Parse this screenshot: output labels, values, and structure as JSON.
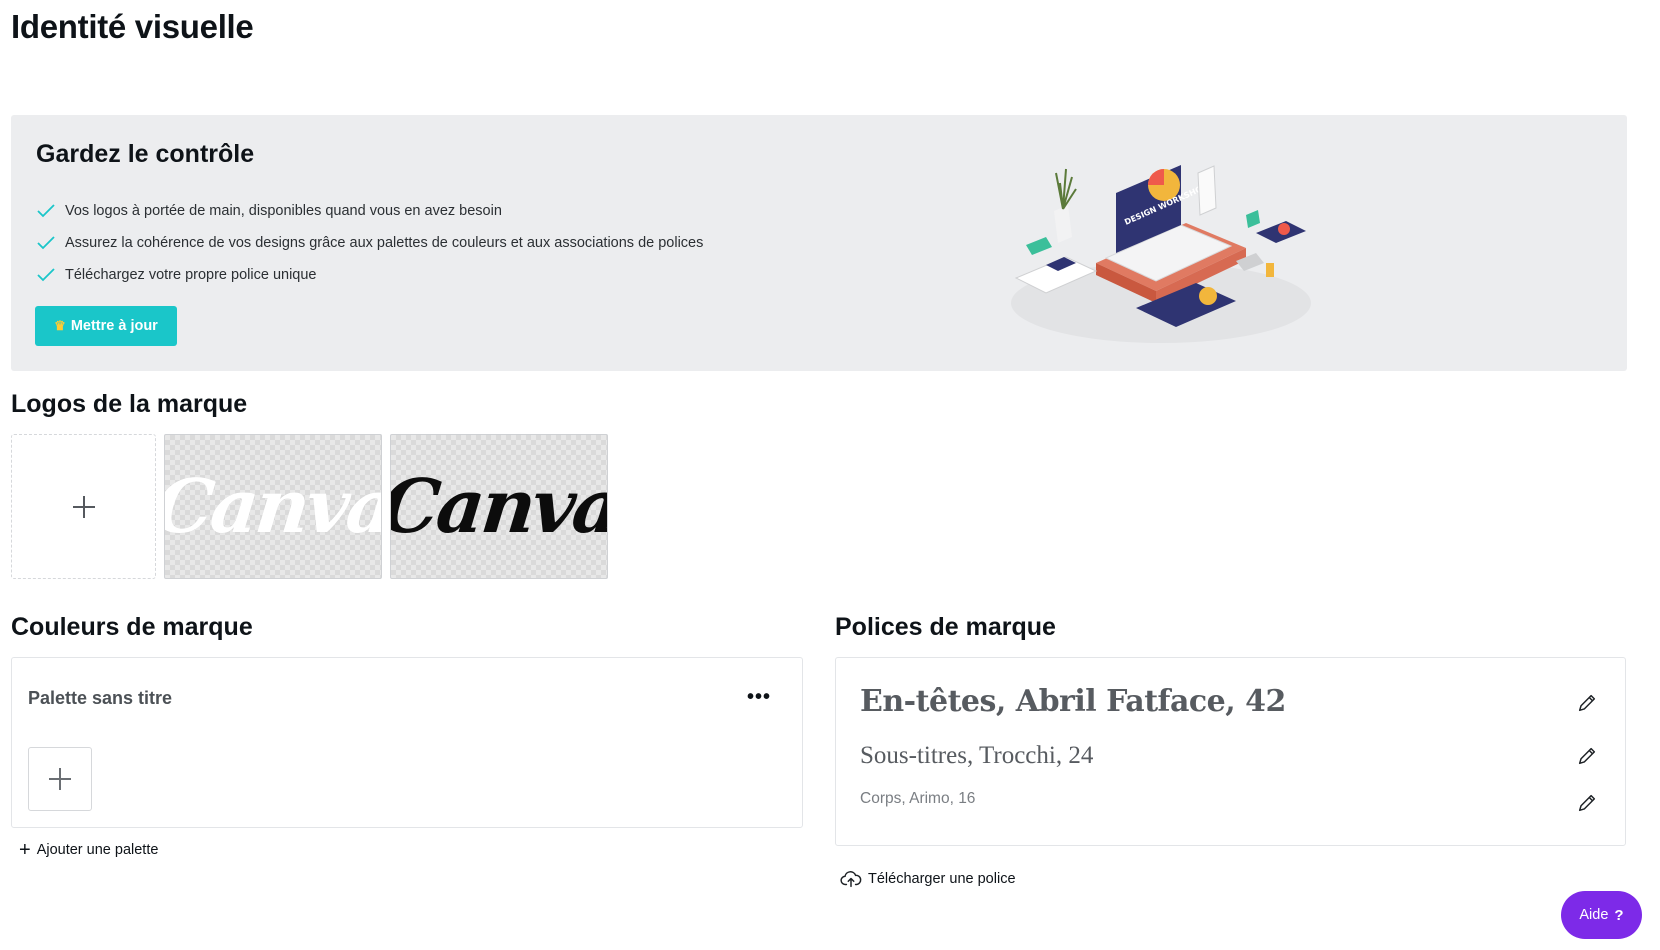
{
  "page": {
    "title": "Identité visuelle"
  },
  "promo": {
    "title": "Gardez le contrôle",
    "features": [
      "Vos logos à portée de main, disponibles quand vous en avez besoin",
      "Assurez la cohérence de vos designs grâce aux palettes de couleurs et aux associations de polices",
      "Téléchargez votre propre police unique"
    ],
    "upgrade_label": "Mettre à jour",
    "upgrade_icon": "crown-icon",
    "accent_color": "#1ac6c9",
    "illustration_text": "DESIGN WORKSHOP"
  },
  "logos": {
    "title": "Logos de la marque",
    "add_icon": "plus-icon",
    "items": [
      {
        "wordmark": "Canva",
        "variant": "white"
      },
      {
        "wordmark": "Canva",
        "variant": "black"
      }
    ]
  },
  "colors": {
    "title": "Couleurs de marque",
    "palette_name": "Palette sans titre",
    "more_icon": "more-horizontal-icon",
    "more_label": "•••",
    "add_color_icon": "plus-icon",
    "add_palette_label": "Ajouter une palette"
  },
  "fonts": {
    "title": "Polices de marque",
    "rows": [
      {
        "label": "En-têtes, Abril Fatface, 42"
      },
      {
        "label": "Sous-titres, Trocchi, 24"
      },
      {
        "label": "Corps, Arimo, 16"
      }
    ],
    "edit_icon": "pencil-icon",
    "upload_label": "Télécharger une police",
    "upload_icon": "cloud-upload-icon"
  },
  "help": {
    "label": "Aide",
    "icon_label": "?",
    "color": "#7d2ae8"
  }
}
